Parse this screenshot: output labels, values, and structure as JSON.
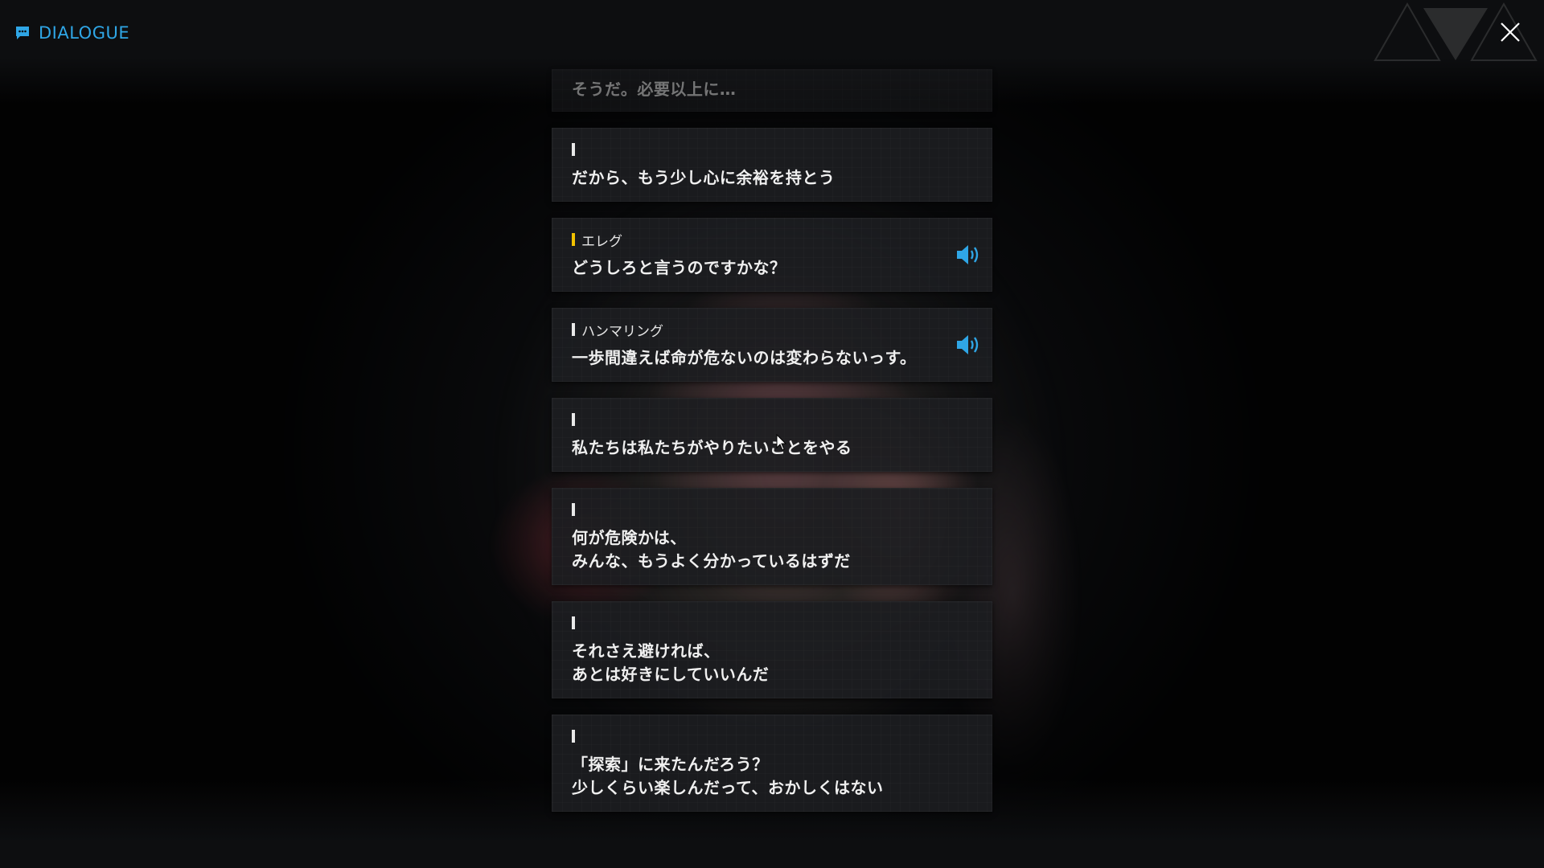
{
  "header": {
    "title": "DIALOGUE",
    "title_icon": "chat-bubble-icon",
    "close_icon": "close-icon"
  },
  "colors": {
    "accent": "#2fa6e6",
    "speaker_highlight": "#f2c200",
    "card_bg": "#1c1d20",
    "text": "#f0f0f0"
  },
  "dialogue": [
    {
      "speaker": "",
      "text": "そうだ。必要以上に…",
      "voice": false,
      "faded": true,
      "marker": false
    },
    {
      "speaker": "",
      "text": "だから、もう少し心に余裕を持とう",
      "voice": false,
      "marker": true,
      "marker_color": "white"
    },
    {
      "speaker": "エレグ",
      "text": "どうしろと言うのですかな？",
      "voice": true,
      "marker": true,
      "marker_color": "gold"
    },
    {
      "speaker": "ハンマリング",
      "text": "一歩間違えば命が危ないのは変わらないっす。",
      "voice": true,
      "marker": true,
      "marker_color": "white"
    },
    {
      "speaker": "",
      "text": "私たちは私たちがやりたいことをやる",
      "voice": false,
      "marker": true,
      "marker_color": "white"
    },
    {
      "speaker": "",
      "text": "何が危険かは、\nみんな、もうよく分かっているはずだ",
      "voice": false,
      "marker": true,
      "marker_color": "white"
    },
    {
      "speaker": "",
      "text": "それさえ避ければ、\nあとは好きにしていいんだ",
      "voice": false,
      "marker": true,
      "marker_color": "white"
    },
    {
      "speaker": "",
      "text": "「探索」に来たんだろう？\n少しくらい楽しんだって、おかしくはない",
      "voice": false,
      "marker": true,
      "marker_color": "white"
    }
  ]
}
